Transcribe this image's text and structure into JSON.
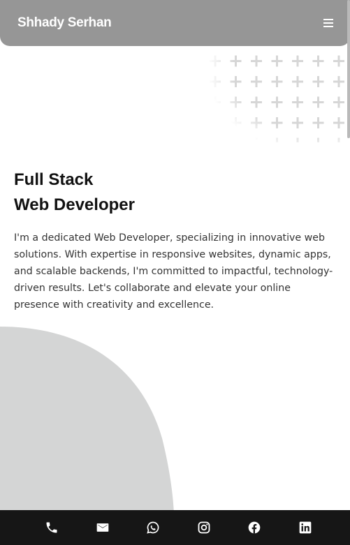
{
  "header": {
    "brand": "Shhady Serhan",
    "menu_icon": "hamburger-menu-icon"
  },
  "hero": {
    "title_line1": "Full Stack",
    "title_line2": "Web Developer",
    "description": "I'm a dedicated Web Developer, specializing in innovative web solutions. With expertise in responsive websites, dynamic apps, and scalable backends, I'm committed to impactful, technology-driven results. Let's collaborate and elevate your online presence with creativity and excellence."
  },
  "footer": {
    "social": [
      {
        "name": "phone-icon"
      },
      {
        "name": "mail-icon"
      },
      {
        "name": "whatsapp-icon"
      },
      {
        "name": "instagram-icon"
      },
      {
        "name": "facebook-icon"
      },
      {
        "name": "linkedin-icon"
      }
    ]
  },
  "colors": {
    "header_bg": "#969696",
    "footer_bg": "#161616",
    "blob": "#d4d5d5",
    "plus_pattern": "#d6d6d6",
    "text": "#111111"
  }
}
